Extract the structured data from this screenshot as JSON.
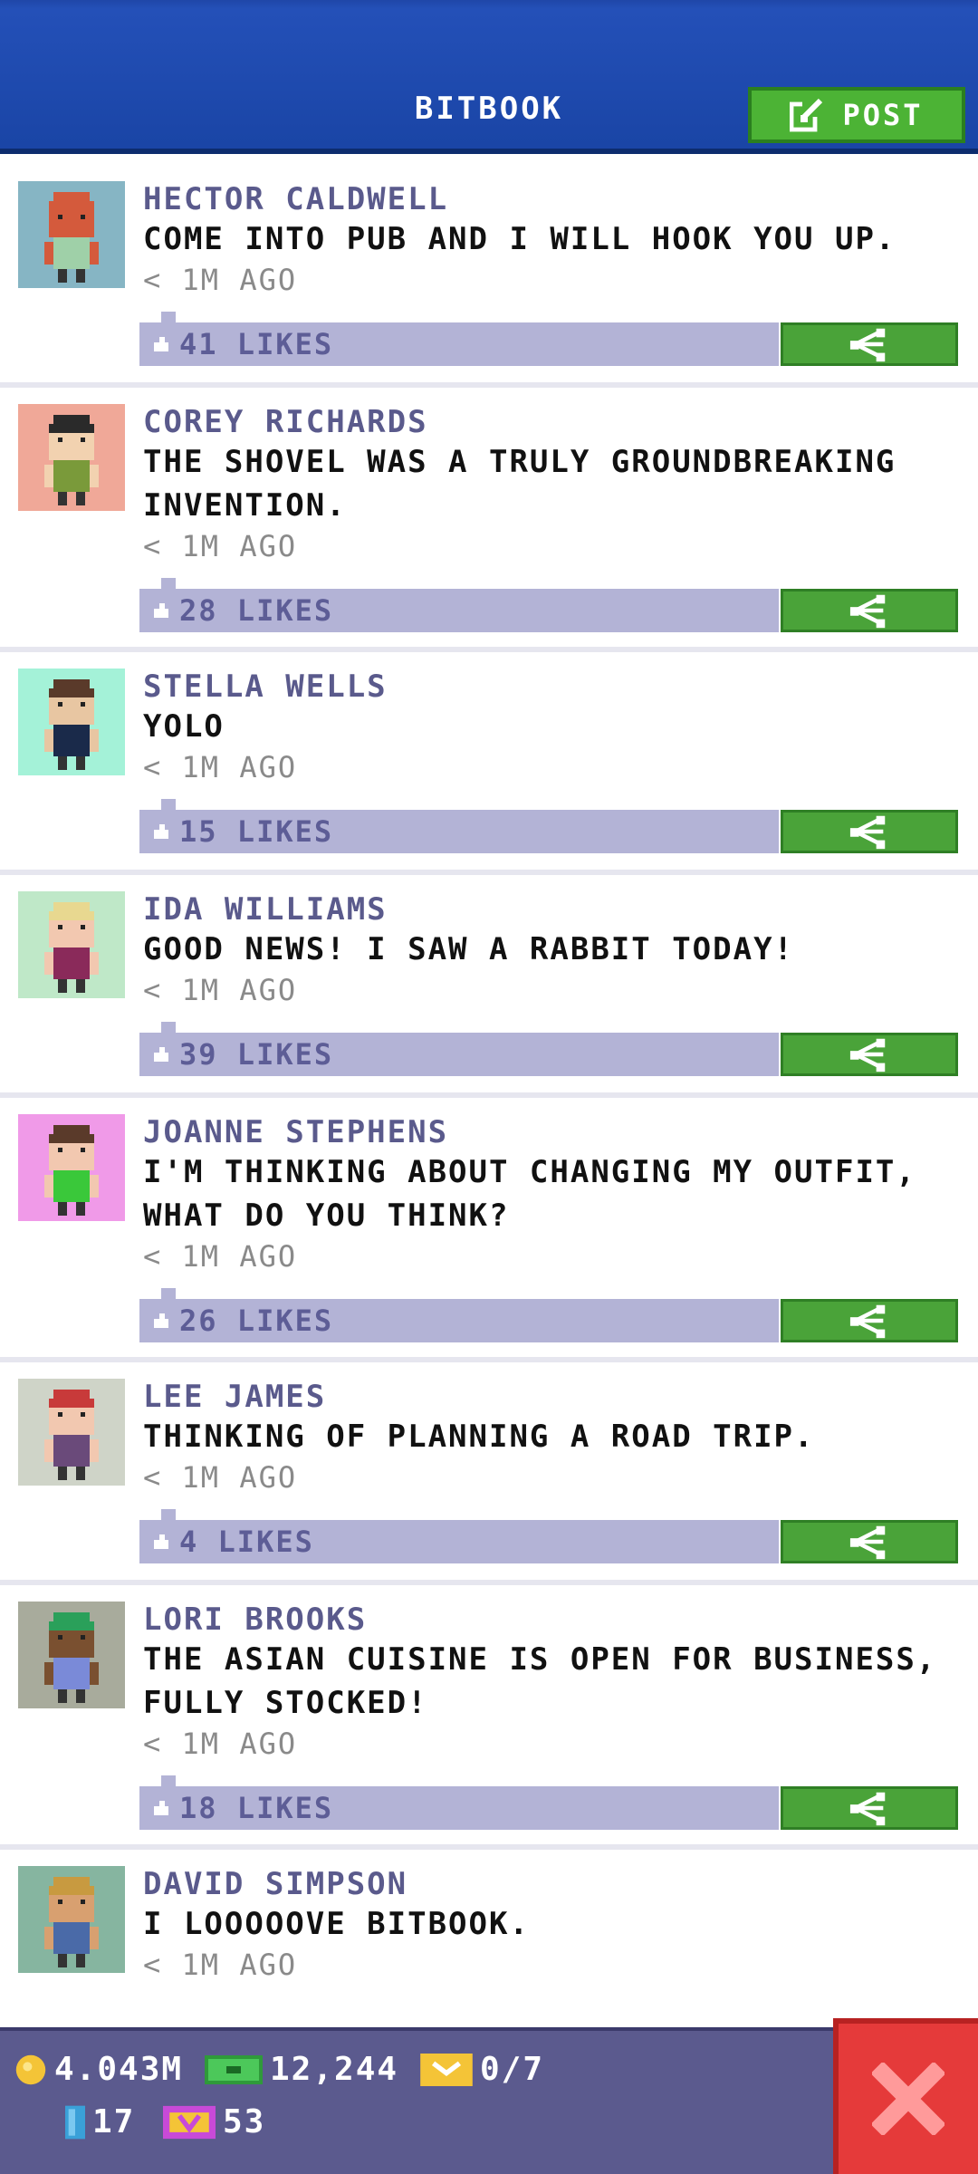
{
  "header": {
    "title": "BITBOOK",
    "post_label": "POST"
  },
  "posts": [
    {
      "name": "HECTOR CALDWELL",
      "text": "COME INTO PUB AND I WILL HOOK YOU UP.",
      "time": "< 1M AGO",
      "likes": "41 LIKES",
      "avatar_bg": "#86b5c4",
      "skin": "#d45a3c",
      "shirt": "#9fd0a8",
      "hair": "#d45a3c"
    },
    {
      "name": "COREY RICHARDS",
      "text": "THE SHOVEL WAS A TRULY GROUNDBREAKING INVENTION.",
      "time": "< 1M AGO",
      "likes": "28 LIKES",
      "avatar_bg": "#f0a898",
      "skin": "#f2d2b0",
      "shirt": "#7a9a3a",
      "hair": "#2a2a2a"
    },
    {
      "name": "STELLA WELLS",
      "text": "YOLO",
      "time": "< 1M AGO",
      "likes": "15 LIKES",
      "avatar_bg": "#a4f2d8",
      "skin": "#e8c6a2",
      "shirt": "#1a2a4a",
      "hair": "#5a3a2a"
    },
    {
      "name": "IDA WILLIAMS",
      "text": "GOOD NEWS! I SAW A RABBIT TODAY!",
      "time": "< 1M AGO",
      "likes": "39 LIKES",
      "avatar_bg": "#bfe8c8",
      "skin": "#f2c8b0",
      "shirt": "#8a2a5a",
      "hair": "#e8d890"
    },
    {
      "name": "JOANNE STEPHENS",
      "text": "I'M THINKING ABOUT CHANGING MY OUTFIT, WHAT DO YOU THINK?",
      "time": "< 1M AGO",
      "likes": "26 LIKES",
      "avatar_bg": "#f09ae8",
      "skin": "#f2c8b0",
      "shirt": "#3ac83a",
      "hair": "#5a3a2a"
    },
    {
      "name": "LEE JAMES",
      "text": "THINKING OF PLANNING A ROAD TRIP.",
      "time": "< 1M AGO",
      "likes": "4 LIKES",
      "avatar_bg": "#cfd4c8",
      "skin": "#f2c8b0",
      "shirt": "#6a4a7a",
      "hair": "#c83a3a"
    },
    {
      "name": "LORI BROOKS",
      "text": "THE ASIAN CUISINE IS OPEN FOR BUSINESS, FULLY STOCKED!",
      "time": "< 1M AGO",
      "likes": "18 LIKES",
      "avatar_bg": "#a8ab9c",
      "skin": "#7a5030",
      "shirt": "#7a8ad8",
      "hair": "#2aa05a"
    },
    {
      "name": "DAVID SIMPSON",
      "text": "I LOOOOOVE BITBOOK.",
      "time": "< 1M AGO",
      "likes": "",
      "avatar_bg": "#86b5a0",
      "skin": "#d8a070",
      "shirt": "#4a6aa8",
      "hair": "#c89a40"
    }
  ],
  "status": {
    "coins": "4.043M",
    "bux": "12,244",
    "tickets": "0/7",
    "vip": "17",
    "gems": "53"
  },
  "colors": {
    "header_blue": "#2450b8",
    "post_green": "#4cb335",
    "likes_bar": "#b3b3d6",
    "close_red": "#e53a3a"
  }
}
